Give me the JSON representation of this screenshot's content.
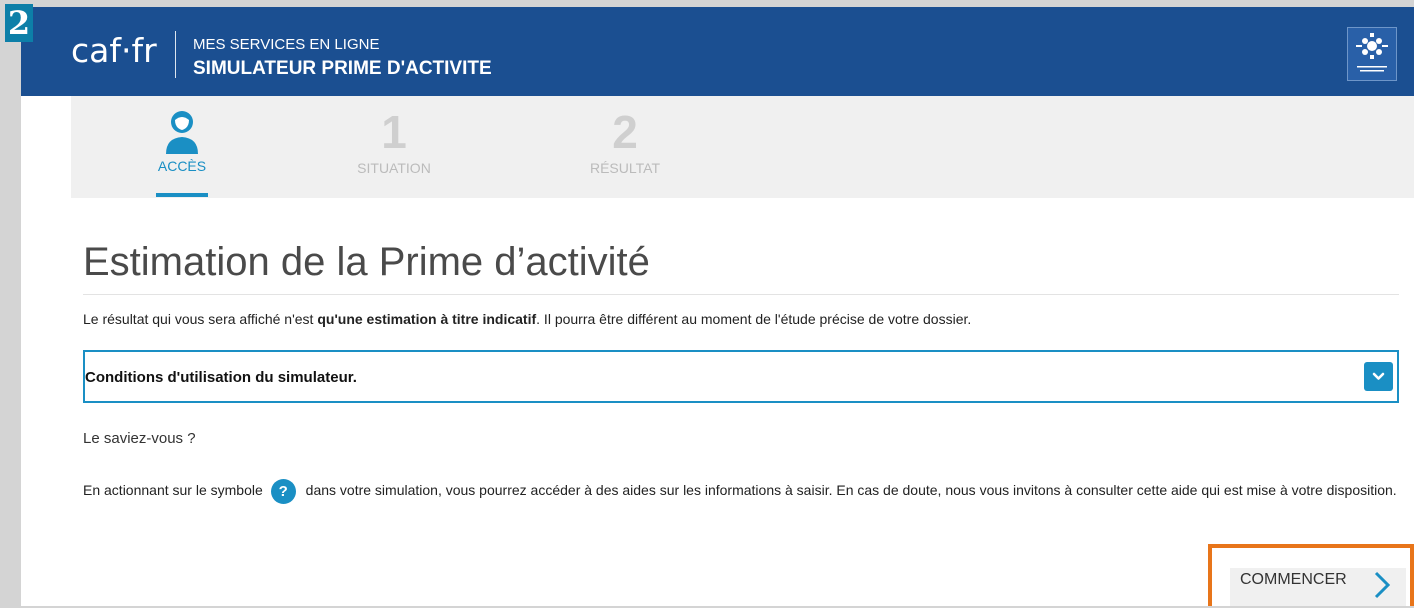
{
  "badge": "2",
  "header": {
    "logo": "caf·fr",
    "subtitle": "MES SERVICES EN LIGNE",
    "title": "SIMULATEUR PRIME D'ACTIVITE",
    "emblem_icon": "caf-emblem-icon"
  },
  "steps": [
    {
      "icon": "user-icon",
      "label": "ACCÈS",
      "active": true
    },
    {
      "number": "1",
      "label": "SITUATION",
      "active": false
    },
    {
      "number": "2",
      "label": "RÉSULTAT",
      "active": false
    }
  ],
  "main": {
    "title": "Estimation de la Prime d’activité",
    "intro_before": "Le résultat qui vous sera affiché n'est ",
    "intro_bold": "qu'une estimation à titre indicatif",
    "intro_after": ". Il pourra être différent au moment de l'étude précise de votre dossier.",
    "accordion_label": "Conditions d'utilisation du simulateur.",
    "did_you_know": "Le saviez-vous ?",
    "help_before": "En actionnant sur le symbole",
    "help_icon_glyph": "?",
    "help_after": "dans votre simulation, vous pourrez accéder à des aides sur les informations à saisir. En cas de doute, nous vous invitons à consulter cette aide qui est mise à votre disposition.",
    "start_label": "COMMENCER"
  },
  "colors": {
    "header_bg": "#1b4f91",
    "accent": "#1a8fc4",
    "highlight": "#e8751a"
  }
}
